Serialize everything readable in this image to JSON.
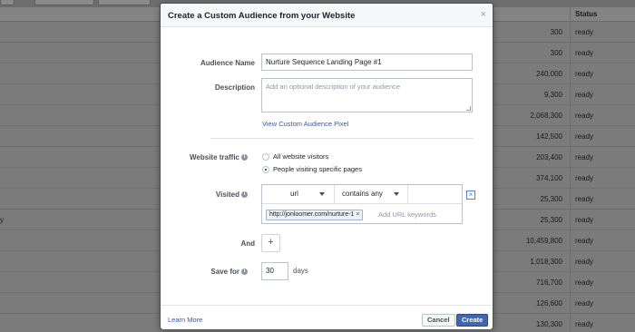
{
  "background_table": {
    "status_header": "Status",
    "rows": [
      {
        "value": "300",
        "status": "ready",
        "left": ""
      },
      {
        "value": "300",
        "status": "ready",
        "left": ""
      },
      {
        "value": "240,000",
        "status": "ready",
        "left": ""
      },
      {
        "value": "9,300",
        "status": "ready",
        "left": ""
      },
      {
        "value": "2,068,300",
        "status": "ready",
        "left": ""
      },
      {
        "value": "142,500",
        "status": "ready",
        "left": ""
      },
      {
        "value": "203,400",
        "status": "ready",
        "left": ""
      },
      {
        "value": "374,100",
        "status": "ready",
        "left": ""
      },
      {
        "value": "25,300",
        "status": "ready",
        "left": ""
      },
      {
        "value": "25,300",
        "status": "ready",
        "left": "y"
      },
      {
        "value": "10,459,800",
        "status": "ready",
        "left": ""
      },
      {
        "value": "1,018,300",
        "status": "ready",
        "left": ""
      },
      {
        "value": "716,700",
        "status": "ready",
        "left": ""
      },
      {
        "value": "126,600",
        "status": "ready",
        "left": ""
      },
      {
        "value": "130,300",
        "status": "ready",
        "left": ""
      }
    ]
  },
  "modal": {
    "title": "Create a Custom Audience from your Website",
    "close_glyph": "×",
    "audience_name_label": "Audience Name",
    "audience_name_value": "Nurture Sequence Landing Page #1",
    "description_label": "Description",
    "description_placeholder": "Add an optional description of your audience",
    "pixel_link": "View Custom Audience Pixel",
    "website_traffic_label": "Website traffic",
    "traffic_options": [
      {
        "label": "All website visitors",
        "selected": false
      },
      {
        "label": "People visiting specific pages",
        "selected": true
      }
    ],
    "visited_label": "Visited",
    "rule_field": "url",
    "rule_operator": "contains any",
    "rule_tag": "http://jonloomer.com/nurture-1",
    "rule_tag_remove": "×",
    "keywords_placeholder": "Add URL keywords",
    "rule_remove_glyph": "×",
    "and_label": "And",
    "add_rule_glyph": "+",
    "save_for_label": "Save for",
    "save_for_value": "30",
    "days_label": "days",
    "info_glyph": "i",
    "learn_more": "Learn More",
    "cancel_label": "Cancel",
    "create_label": "Create"
  },
  "colors": {
    "brand_blue": "#4267b2",
    "link_blue": "#3b5998",
    "overlay_gray": "#7b7b7b"
  },
  "icons": [
    "close-icon",
    "info-icon",
    "caret-down-icon",
    "remove-rule-icon",
    "plus-icon"
  ]
}
